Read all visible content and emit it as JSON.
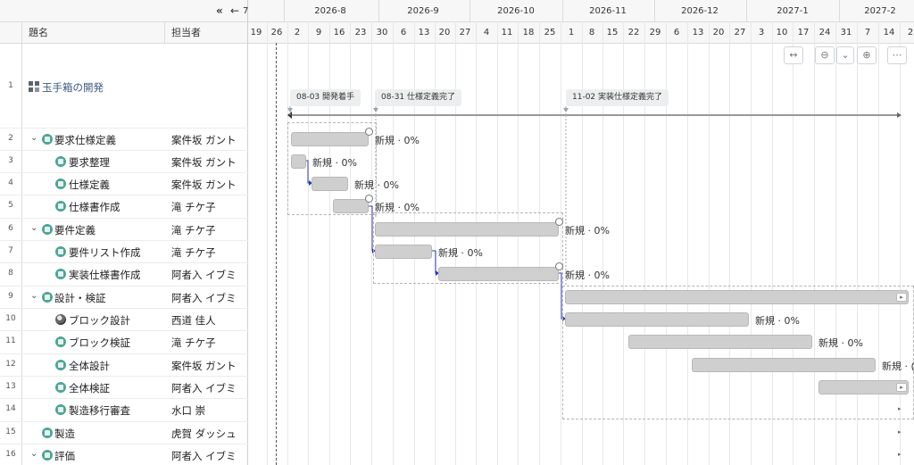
{
  "columns": {
    "title": "題名",
    "assignee": "担当者"
  },
  "nav": {
    "scroll_left": "«",
    "jump_today": "←",
    "truncated": "7"
  },
  "months": [
    "2026-8",
    "2026-9",
    "2026-10",
    "2026-11",
    "2026-12",
    "2027-1",
    "2027-2"
  ],
  "weeks": [
    "19",
    "26",
    "2",
    "9",
    "16",
    "23",
    "30",
    "6",
    "13",
    "20",
    "27",
    "4",
    "11",
    "18",
    "25",
    "1",
    "8",
    "15",
    "22",
    "29",
    "6",
    "13",
    "20",
    "27",
    "3",
    "10",
    "17",
    "24",
    "31",
    "7",
    "14",
    "2"
  ],
  "milestones": [
    {
      "label": "08-03 開発着手"
    },
    {
      "label": "08-31 仕様定義完了"
    },
    {
      "label": "11-02 実装仕様定義完了"
    }
  ],
  "bar_status": "新規 · 0%",
  "bar_status_truncated": "新規 · (",
  "rows": [
    {
      "num": "1",
      "title": "玉手箱の開発",
      "assignee": "",
      "type": "project"
    },
    {
      "num": "2",
      "title": "要求仕様定義",
      "assignee": "案件坂 ガント",
      "type": "group"
    },
    {
      "num": "3",
      "title": "要求整理",
      "assignee": "案件坂 ガント",
      "type": "task"
    },
    {
      "num": "4",
      "title": "仕様定義",
      "assignee": "案件坂 ガント",
      "type": "task"
    },
    {
      "num": "5",
      "title": "仕様書作成",
      "assignee": "滝 チケ子",
      "type": "task"
    },
    {
      "num": "6",
      "title": "要件定義",
      "assignee": "滝 チケ子",
      "type": "group"
    },
    {
      "num": "7",
      "title": "要件リスト作成",
      "assignee": "滝 チケ子",
      "type": "task"
    },
    {
      "num": "8",
      "title": "実装仕様書作成",
      "assignee": "阿者入 イブミ",
      "type": "task"
    },
    {
      "num": "9",
      "title": "設計・検証",
      "assignee": "阿者入 イブミ",
      "type": "group"
    },
    {
      "num": "10",
      "title": "ブロック設計",
      "assignee": "西道 佳人",
      "type": "task-avatar"
    },
    {
      "num": "11",
      "title": "ブロック検証",
      "assignee": "滝 チケ子",
      "type": "task"
    },
    {
      "num": "12",
      "title": "全体設計",
      "assignee": "案件坂 ガント",
      "type": "task"
    },
    {
      "num": "13",
      "title": "全体検証",
      "assignee": "阿者入 イブミ",
      "type": "task"
    },
    {
      "num": "14",
      "title": "製造移行審査",
      "assignee": "水口 崇",
      "type": "task"
    },
    {
      "num": "15",
      "title": "製造",
      "assignee": "虎賀 ダッシュ",
      "type": "item"
    },
    {
      "num": "16",
      "title": "評価",
      "assignee": "阿者入 イブミ",
      "type": "group"
    }
  ],
  "toolbar": {
    "fit": "fit-width-icon",
    "zoom_out": "zoom-out-icon",
    "dropdown": "chevron-down-icon",
    "zoom_in": "zoom-in-icon",
    "more": "more-icon"
  },
  "colors": {
    "accent": "#4fa595",
    "bar": "#cfcfcf",
    "link": "#2b3bb5",
    "link_text": "#3d5a80"
  }
}
